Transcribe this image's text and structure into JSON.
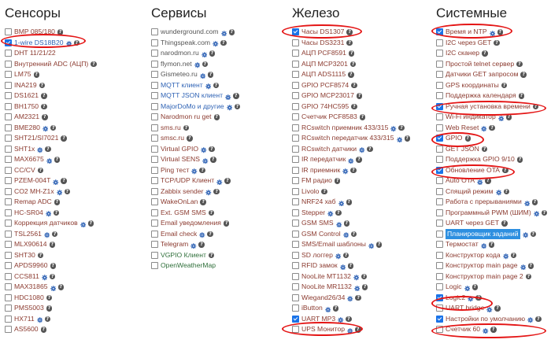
{
  "columns": [
    {
      "id": "sensors",
      "title": "Сенсоры",
      "items": [
        {
          "label": "BMP 085/180",
          "checked": false,
          "gear": false,
          "help": true,
          "color": "red"
        },
        {
          "label": "1-wire DS18B20",
          "checked": true,
          "gear": true,
          "help": true,
          "color": "blue"
        },
        {
          "label": "DHT 11/21/22",
          "checked": false,
          "gear": false,
          "help": false,
          "color": "red"
        },
        {
          "label": "Внутренний ADC (АЦП)",
          "checked": false,
          "gear": false,
          "help": true,
          "color": "red"
        },
        {
          "label": "LM75",
          "checked": false,
          "gear": false,
          "help": true,
          "color": "red"
        },
        {
          "label": "INA219",
          "checked": false,
          "gear": false,
          "help": true,
          "color": "red"
        },
        {
          "label": "DS1621",
          "checked": false,
          "gear": false,
          "help": true,
          "color": "red"
        },
        {
          "label": "BH1750",
          "checked": false,
          "gear": false,
          "help": true,
          "color": "red"
        },
        {
          "label": "AM2321",
          "checked": false,
          "gear": false,
          "help": true,
          "color": "red"
        },
        {
          "label": "BME280",
          "checked": false,
          "gear": true,
          "help": true,
          "color": "red"
        },
        {
          "label": "SHT21/SI7021",
          "checked": false,
          "gear": false,
          "help": true,
          "color": "red"
        },
        {
          "label": "SHT1x",
          "checked": false,
          "gear": true,
          "help": true,
          "color": "red"
        },
        {
          "label": "MAX6675",
          "checked": false,
          "gear": true,
          "help": true,
          "color": "red"
        },
        {
          "label": "CC/CV",
          "checked": false,
          "gear": false,
          "help": true,
          "color": "red"
        },
        {
          "label": "PZEM-004T",
          "checked": false,
          "gear": true,
          "help": true,
          "color": "red"
        },
        {
          "label": "CO2 MH-Z1x",
          "checked": false,
          "gear": true,
          "help": true,
          "color": "red"
        },
        {
          "label": "Remap ADC",
          "checked": false,
          "gear": false,
          "help": true,
          "color": "red"
        },
        {
          "label": "HC-SR04",
          "checked": false,
          "gear": true,
          "help": true,
          "color": "red"
        },
        {
          "label": "Коррекция датчиков",
          "checked": false,
          "gear": true,
          "help": true,
          "color": "red"
        },
        {
          "label": "TSL2561",
          "checked": false,
          "gear": true,
          "help": true,
          "color": "red"
        },
        {
          "label": "MLX90614",
          "checked": false,
          "gear": false,
          "help": true,
          "color": "red"
        },
        {
          "label": "SHT30",
          "checked": false,
          "gear": false,
          "help": true,
          "color": "red"
        },
        {
          "label": "APDS9960",
          "checked": false,
          "gear": false,
          "help": true,
          "color": "red"
        },
        {
          "label": "CCS811",
          "checked": false,
          "gear": true,
          "help": true,
          "color": "red"
        },
        {
          "label": "MAX31865",
          "checked": false,
          "gear": true,
          "help": true,
          "color": "red"
        },
        {
          "label": "HDC1080",
          "checked": false,
          "gear": false,
          "help": true,
          "color": "red"
        },
        {
          "label": "PMS5003",
          "checked": false,
          "gear": false,
          "help": true,
          "color": "red"
        },
        {
          "label": "HX711",
          "checked": false,
          "gear": true,
          "help": true,
          "color": "red"
        },
        {
          "label": "AS5600",
          "checked": false,
          "gear": false,
          "help": true,
          "color": "red"
        }
      ]
    },
    {
      "id": "services",
      "title": "Сервисы",
      "items": [
        {
          "label": "wunderground.com",
          "checked": false,
          "gear": true,
          "help": true,
          "color": "gray"
        },
        {
          "label": "Thingspeak.com",
          "checked": false,
          "gear": true,
          "help": true,
          "color": "gray"
        },
        {
          "label": "narodmon.ru",
          "checked": false,
          "gear": true,
          "help": true,
          "color": "gray"
        },
        {
          "label": "flymon.net",
          "checked": false,
          "gear": true,
          "help": true,
          "color": "gray"
        },
        {
          "label": "Gismeteo.ru",
          "checked": false,
          "gear": true,
          "help": true,
          "color": "gray"
        },
        {
          "label": "MQTT клиент",
          "checked": false,
          "gear": true,
          "help": true,
          "color": "blue"
        },
        {
          "label": "MQTT JSON клиент",
          "checked": false,
          "gear": true,
          "help": true,
          "color": "blue"
        },
        {
          "label": "MajorDoMo и другие",
          "checked": false,
          "gear": true,
          "help": true,
          "color": "blue"
        },
        {
          "label": "Narodmon ru get",
          "checked": false,
          "gear": false,
          "help": true,
          "color": "red"
        },
        {
          "label": "sms.ru",
          "checked": false,
          "gear": false,
          "help": true,
          "color": "red"
        },
        {
          "label": "smsc.ru",
          "checked": false,
          "gear": false,
          "help": true,
          "color": "red"
        },
        {
          "label": "Virtual GPIO",
          "checked": false,
          "gear": true,
          "help": true,
          "color": "red"
        },
        {
          "label": "Virtual SENS",
          "checked": false,
          "gear": true,
          "help": true,
          "color": "red"
        },
        {
          "label": "Ping тест",
          "checked": false,
          "gear": true,
          "help": true,
          "color": "red"
        },
        {
          "label": "TCP/UDP Клиент",
          "checked": false,
          "gear": true,
          "help": true,
          "color": "red"
        },
        {
          "label": "Zabbix sender",
          "checked": false,
          "gear": true,
          "help": true,
          "color": "red"
        },
        {
          "label": "WakeOnLan",
          "checked": false,
          "gear": false,
          "help": true,
          "color": "red"
        },
        {
          "label": "Ext. GSM SMS",
          "checked": false,
          "gear": false,
          "help": true,
          "color": "red"
        },
        {
          "label": "Email уведомления",
          "checked": false,
          "gear": false,
          "help": true,
          "color": "red"
        },
        {
          "label": "Email check",
          "checked": false,
          "gear": true,
          "help": true,
          "color": "red"
        },
        {
          "label": "Telegram",
          "checked": false,
          "gear": true,
          "help": true,
          "color": "red"
        },
        {
          "label": "VGPIO Клиент",
          "checked": false,
          "gear": false,
          "help": true,
          "color": "green"
        },
        {
          "label": "OpenWeatherMap",
          "checked": false,
          "gear": false,
          "help": false,
          "color": "green"
        }
      ]
    },
    {
      "id": "hardware",
      "title": "Железо",
      "items": [
        {
          "label": "Часы DS1307",
          "checked": true,
          "gear": false,
          "help": true,
          "color": "red"
        },
        {
          "label": "Часы DS3231",
          "checked": false,
          "gear": false,
          "help": true,
          "color": "red"
        },
        {
          "label": "АЦП PCF8591",
          "checked": false,
          "gear": false,
          "help": true,
          "color": "red"
        },
        {
          "label": "АЦП MCP3201",
          "checked": false,
          "gear": false,
          "help": true,
          "color": "red"
        },
        {
          "label": "АЦП ADS1115",
          "checked": false,
          "gear": false,
          "help": true,
          "color": "red"
        },
        {
          "label": "GPIO PCF8574",
          "checked": false,
          "gear": false,
          "help": true,
          "color": "red"
        },
        {
          "label": "GPIO MCP23017",
          "checked": false,
          "gear": false,
          "help": true,
          "color": "red"
        },
        {
          "label": "GPIO 74HC595",
          "checked": false,
          "gear": false,
          "help": true,
          "color": "red"
        },
        {
          "label": "Счетчик PCF8583",
          "checked": false,
          "gear": false,
          "help": true,
          "color": "red"
        },
        {
          "label": "RCswitch приемник 433/315",
          "checked": false,
          "gear": true,
          "help": true,
          "color": "red"
        },
        {
          "label": "RCswitch передатчик 433/315",
          "checked": false,
          "gear": true,
          "help": true,
          "color": "red"
        },
        {
          "label": "RCswitch датчики",
          "checked": false,
          "gear": true,
          "help": true,
          "color": "red"
        },
        {
          "label": "IR передатчик",
          "checked": false,
          "gear": true,
          "help": true,
          "color": "red"
        },
        {
          "label": "IR приемник",
          "checked": false,
          "gear": true,
          "help": true,
          "color": "red"
        },
        {
          "label": "FM радио",
          "checked": false,
          "gear": false,
          "help": true,
          "color": "red"
        },
        {
          "label": "Livolo",
          "checked": false,
          "gear": false,
          "help": true,
          "color": "red"
        },
        {
          "label": "NRF24 хаб",
          "checked": false,
          "gear": true,
          "help": true,
          "color": "red"
        },
        {
          "label": "Stepper",
          "checked": false,
          "gear": true,
          "help": true,
          "color": "red"
        },
        {
          "label": "GSM SMS",
          "checked": false,
          "gear": true,
          "help": true,
          "color": "red"
        },
        {
          "label": "GSM Control",
          "checked": false,
          "gear": true,
          "help": true,
          "color": "red"
        },
        {
          "label": "SMS/Email шаблоны",
          "checked": false,
          "gear": true,
          "help": true,
          "color": "red"
        },
        {
          "label": "SD логгер",
          "checked": false,
          "gear": true,
          "help": true,
          "color": "red"
        },
        {
          "label": "RFID замок",
          "checked": false,
          "gear": true,
          "help": true,
          "color": "red"
        },
        {
          "label": "NooLite MT1132",
          "checked": false,
          "gear": true,
          "help": true,
          "color": "red"
        },
        {
          "label": "NooLite MR1132",
          "checked": false,
          "gear": true,
          "help": true,
          "color": "red"
        },
        {
          "label": "Wiegand26/34",
          "checked": false,
          "gear": true,
          "help": true,
          "color": "red"
        },
        {
          "label": "iButton",
          "checked": false,
          "gear": true,
          "help": true,
          "color": "red"
        },
        {
          "label": "UART MP3",
          "checked": true,
          "gear": true,
          "help": true,
          "color": "red"
        },
        {
          "label": "UPS Монитор",
          "checked": false,
          "gear": true,
          "help": true,
          "color": "red"
        }
      ]
    },
    {
      "id": "system",
      "title": "Системные",
      "items": [
        {
          "label": "Время и NTP",
          "checked": true,
          "gear": true,
          "help": true,
          "color": "red"
        },
        {
          "label": "I2C через GET",
          "checked": false,
          "gear": false,
          "help": true,
          "color": "red"
        },
        {
          "label": "I2C сканер",
          "checked": false,
          "gear": false,
          "help": true,
          "color": "red"
        },
        {
          "label": "Простой telnet сервер",
          "checked": false,
          "gear": false,
          "help": true,
          "color": "red"
        },
        {
          "label": "Датчики GET запросом",
          "checked": false,
          "gear": false,
          "help": true,
          "color": "red"
        },
        {
          "label": "GPS координаты",
          "checked": false,
          "gear": false,
          "help": true,
          "color": "red"
        },
        {
          "label": "Поддержка календаря",
          "checked": false,
          "gear": false,
          "help": true,
          "color": "red"
        },
        {
          "label": "Ручная установка времени",
          "checked": true,
          "gear": false,
          "help": true,
          "color": "red"
        },
        {
          "label": "Wi-Fi индикатор",
          "checked": false,
          "gear": true,
          "help": true,
          "color": "red"
        },
        {
          "label": "Web Reset",
          "checked": false,
          "gear": true,
          "help": true,
          "color": "red"
        },
        {
          "label": "GPIO",
          "checked": true,
          "gear": false,
          "help": true,
          "color": "red"
        },
        {
          "label": "GET JSON",
          "checked": false,
          "gear": false,
          "help": true,
          "color": "red"
        },
        {
          "label": "Поддержка GPIO 9/10",
          "checked": false,
          "gear": false,
          "help": true,
          "color": "red"
        },
        {
          "label": "Обновление OTA",
          "checked": true,
          "gear": false,
          "help": true,
          "color": "red"
        },
        {
          "label": "Auto OTA",
          "checked": false,
          "gear": true,
          "help": true,
          "color": "red"
        },
        {
          "label": "Спящий режим",
          "checked": false,
          "gear": true,
          "help": true,
          "color": "red"
        },
        {
          "label": "Работа с прерываниями",
          "checked": false,
          "gear": true,
          "help": true,
          "color": "red"
        },
        {
          "label": "Программный PWM (ШИМ)",
          "checked": false,
          "gear": true,
          "help": true,
          "color": "red"
        },
        {
          "label": "UART через GET",
          "checked": false,
          "gear": false,
          "help": true,
          "color": "red"
        },
        {
          "label": "Планировщик заданий",
          "checked": false,
          "gear": true,
          "help": true,
          "color": "red",
          "highlight": true
        },
        {
          "label": "Термостат",
          "checked": false,
          "gear": true,
          "help": true,
          "color": "red"
        },
        {
          "label": "Конструктор кода",
          "checked": false,
          "gear": true,
          "help": true,
          "color": "red"
        },
        {
          "label": "Конструктор main page",
          "checked": false,
          "gear": true,
          "help": true,
          "color": "red"
        },
        {
          "label": "Конструктор main page 2",
          "checked": false,
          "gear": false,
          "help": true,
          "color": "red"
        },
        {
          "label": "Logic",
          "checked": false,
          "gear": true,
          "help": true,
          "color": "red"
        },
        {
          "label": "Logic2",
          "checked": true,
          "gear": true,
          "help": true,
          "color": "red"
        },
        {
          "label": "UART bridge",
          "checked": false,
          "gear": true,
          "help": true,
          "color": "red"
        },
        {
          "label": "Настройки по умолчанию",
          "checked": true,
          "gear": true,
          "help": true,
          "color": "red"
        },
        {
          "label": "Счетчик 60",
          "checked": false,
          "gear": true,
          "help": true,
          "color": "red"
        }
      ]
    }
  ],
  "colors": {
    "red": "#8b3a2f",
    "blue": "#2f63b5",
    "gray": "#555555",
    "green": "#2f6f3a",
    "accent": "#1a73e8",
    "oval": "#e41515",
    "highlight": "#2d8fe0"
  }
}
